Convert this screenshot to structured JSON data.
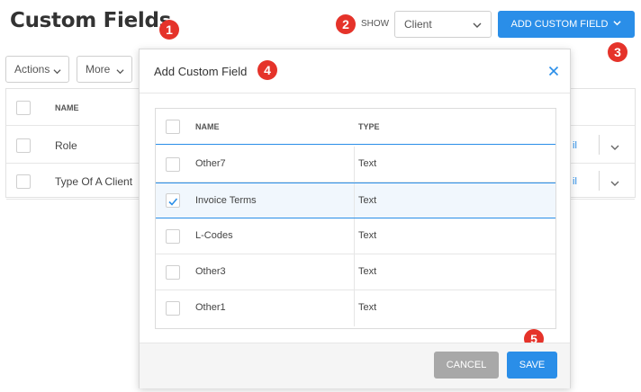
{
  "page": {
    "title": "Custom Fields"
  },
  "badges": [
    "1",
    "2",
    "3",
    "4",
    "5"
  ],
  "toolbar": {
    "show_label": "SHOW",
    "show_select_value": "Client",
    "add_button_label": "ADD CUSTOM FIELD",
    "actions_label": "Actions",
    "more_label": "More"
  },
  "background_table": {
    "header_name": "NAME",
    "rows": [
      {
        "name": "Role",
        "link_fragment": "il"
      },
      {
        "name": "Type Of A Client",
        "link_fragment": "il"
      }
    ]
  },
  "modal": {
    "title": "Add Custom Field",
    "columns": {
      "name": "NAME",
      "type": "TYPE"
    },
    "rows": [
      {
        "name": "Other7",
        "type": "Text",
        "checked": false
      },
      {
        "name": "Invoice Terms",
        "type": "Text",
        "checked": true
      },
      {
        "name": "L-Codes",
        "type": "Text",
        "checked": false
      },
      {
        "name": "Other3",
        "type": "Text",
        "checked": false
      },
      {
        "name": "Other1",
        "type": "Text",
        "checked": false
      }
    ],
    "cancel_label": "CANCEL",
    "save_label": "SAVE"
  },
  "colors": {
    "primary": "#2a8ee8",
    "badge": "#e5332a",
    "cancel": "#a8a8a8"
  },
  "icons": {
    "dropdown": "chevron-down-icon",
    "close": "close-icon",
    "check": "check-icon"
  }
}
